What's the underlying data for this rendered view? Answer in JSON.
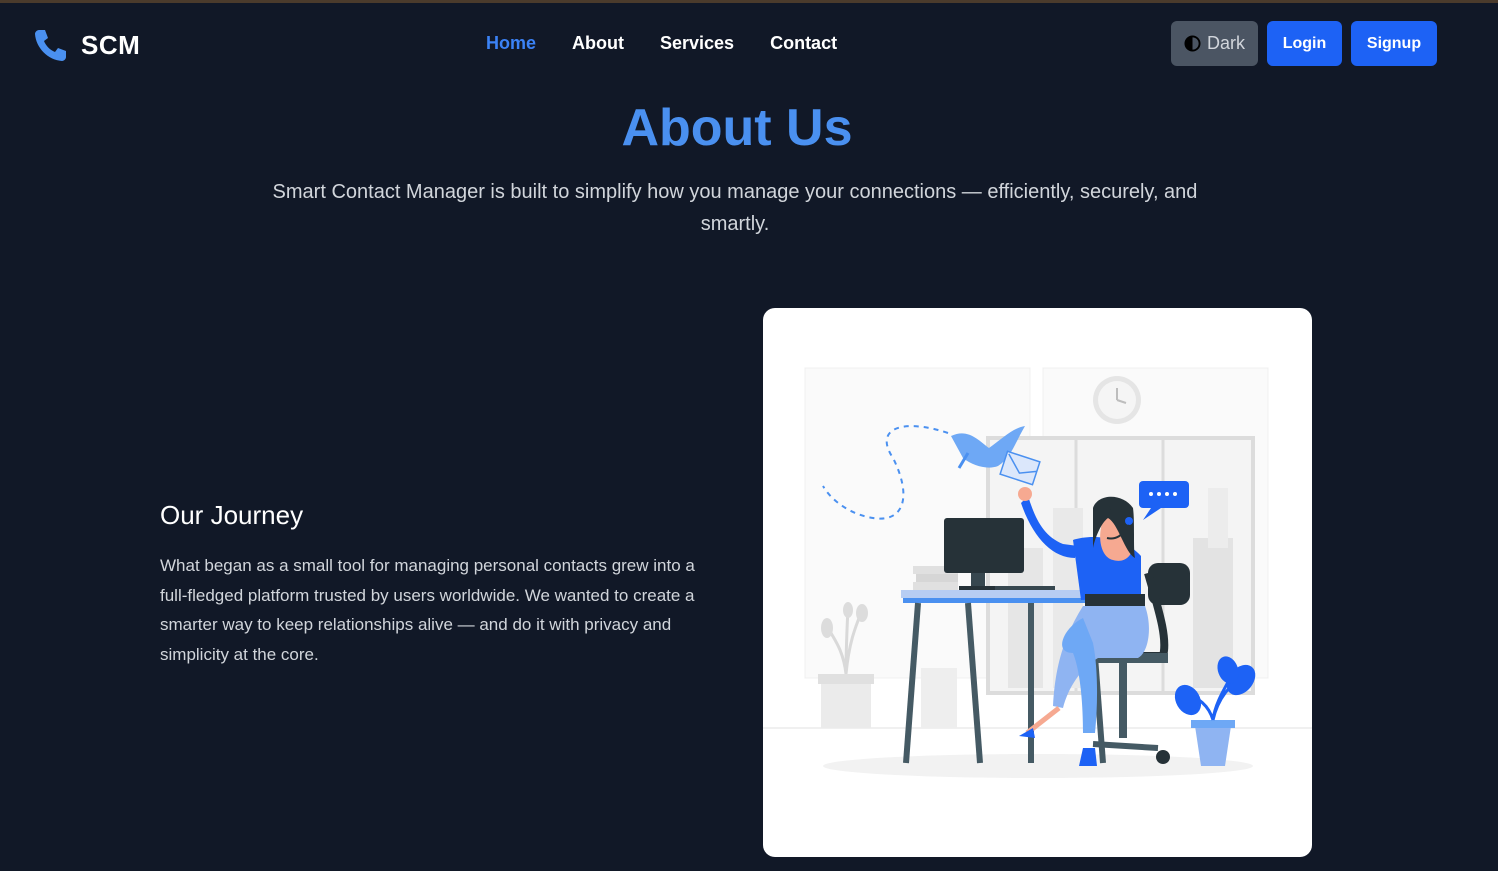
{
  "nav": {
    "brand": "SCM",
    "links": [
      "Home",
      "About",
      "Services",
      "Contact"
    ],
    "active_link": "Home",
    "theme_toggle": "Dark",
    "login": "Login",
    "signup": "Signup"
  },
  "hero": {
    "title": "About Us",
    "subtitle": "Smart Contact Manager is built to simplify how you manage your connections — efficiently, securely, and smartly."
  },
  "journey": {
    "title": "Our Journey",
    "text": "What began as a small tool for managing personal contacts grew into a full-fledged platform trusted by users worldwide. We wanted to create a smarter way to keep relationships alive — and do it with privacy and simplicity at the core."
  },
  "colors": {
    "background": "#111827",
    "accent": "#3b82f6",
    "title_blue": "#4a90f0",
    "button_blue": "#1d62f5",
    "toggle_gray": "#4b5563"
  },
  "icons": {
    "logo": "phone-icon",
    "theme": "half-circle-contrast-icon"
  }
}
